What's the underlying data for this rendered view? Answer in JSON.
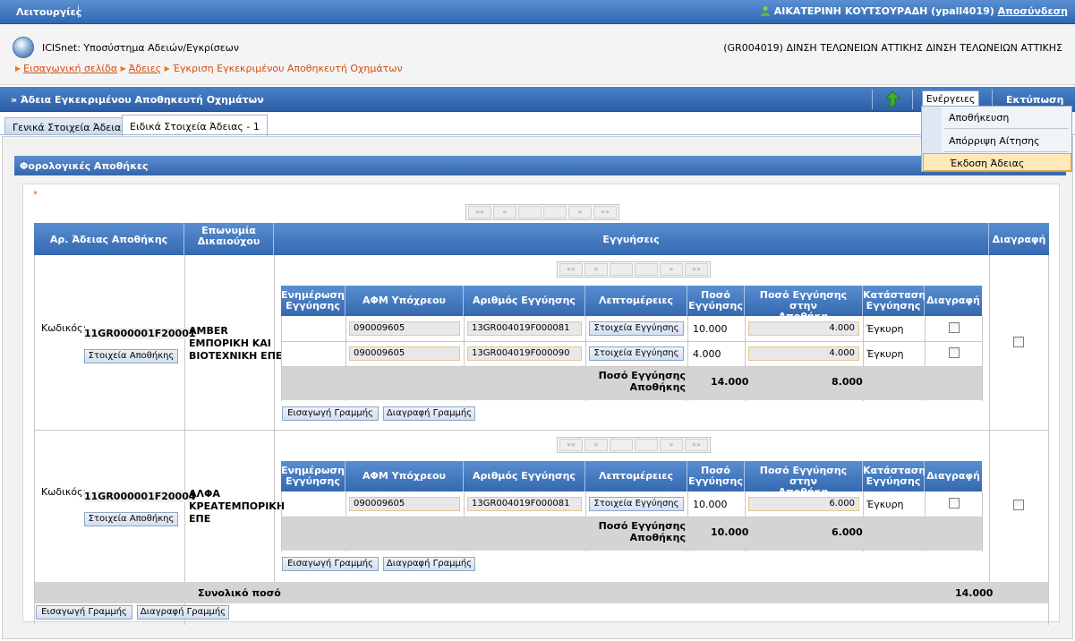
{
  "topbar": {
    "menu": "Λειτουργίες",
    "user": "ΑΙΚΑΤΕΡΙΝΗ ΚΟΥΤΣΟΥΡΑΔΗ (ypall4019)",
    "logout": "Αποσύνδεση"
  },
  "header": {
    "system": "ICISnet: Υποσύστημα Αδειών/Εγκρίσεων",
    "office": "(GR004019) ΔΙΝΣΗ ΤΕΛΩΝΕΙΩΝ ΑΤΤΙΚΗΣ ΔΙΝΣΗ ΤΕΛΩΝΕΙΩΝ ΑΤΤΙΚΗΣ",
    "breadcrumbs": [
      "Εισαγωγική σελίδα",
      "Άδειες",
      "Έγκριση Εγκεκριμένου Αποθηκευτή Οχημάτων"
    ]
  },
  "titlebar": {
    "title": "» Άδεια Εγκεκριμένου Αποθηκευτή Οχημάτων",
    "actions": "Ενέργειες",
    "print": "Εκτύπωση"
  },
  "dropdown": {
    "items": [
      "Αποθήκευση",
      "Απόρριψη Αίτησης",
      "Έκδοση Άδειας"
    ],
    "selected": 2
  },
  "tabs": [
    {
      "label": "Γενικά Στοιχεία Άδειας",
      "active": false
    },
    {
      "label": "Ειδικά Στοιχεία Άδειας - 1",
      "active": true
    }
  ],
  "section": {
    "title": "Φορολογικές Αποθήκες",
    "required_mark": "*"
  },
  "pager": [
    "««",
    "«",
    "",
    "",
    "»",
    "»»"
  ],
  "columns": {
    "license": "Αρ. Άδειας Αποθήκης",
    "holder_1": "Επωνυμία",
    "holder_2": "Δικαιούχου",
    "guarantees": "Εγγυήσεις",
    "delete": "Διαγραφή"
  },
  "subcolumns": {
    "update_1": "Ενημέρωση",
    "update_2": "Εγγύησης",
    "afm": "ΑΦΜ Υπόχρεου",
    "number": "Αριθμός Εγγύησης",
    "details": "Λεπτομέρειες",
    "amount_1": "Ποσό",
    "amount_2": "Εγγύησης",
    "store_1": "Ποσό Εγγύησης στην",
    "store_2": "Αποθήκη",
    "status_1": "Κατάσταση",
    "status_2": "Εγγύησης",
    "delete": "Διαγραφή"
  },
  "labels": {
    "code": "Κωδικός:",
    "store_details": "Στοιχεία Αποθήκης",
    "guarantee_details": "Στοιχεία Εγγύησης",
    "total_store_1": "Ποσό Εγγύησης",
    "total_store_2": "Αποθήκης",
    "insert_row": "Εισαγωγή Γραμμής",
    "delete_row": "Διαγραφή Γραμμής",
    "grand_total": "Συνολικό ποσό"
  },
  "warehouses": [
    {
      "code": "11GR000001F20001",
      "holder": [
        "AMBER",
        "ΕΜΠΟΡΙΚΗ ΚΑΙ",
        "ΒΙΟΤΕΧΝΙΚΗ ΕΠΕ"
      ],
      "rows": [
        {
          "afm": "090009605",
          "number": "13GR004019F000081",
          "amount": "10.000",
          "store": "4.000",
          "status": "Έγκυρη"
        },
        {
          "afm": "090009605",
          "number": "13GR004019F000090",
          "amount": "4.000",
          "store": "4.000",
          "status": "Έγκυρη"
        }
      ],
      "total_amount": "14.000",
      "total_store": "8.000"
    },
    {
      "code": "11GR000001F20004",
      "holder": [
        "ΑΛΦΑ",
        "ΚΡΕΑΤΕΜΠΟΡΙΚΗ",
        "ΕΠΕ"
      ],
      "rows": [
        {
          "afm": "090009605",
          "number": "13GR004019F000081",
          "amount": "10.000",
          "store": "6.000",
          "status": "Έγκυρη"
        }
      ],
      "total_amount": "10.000",
      "total_store": "6.000"
    }
  ],
  "grand_total": "14.000",
  "colors": {
    "accent": "#3468b0",
    "breadcrumb": "#d04e10"
  }
}
